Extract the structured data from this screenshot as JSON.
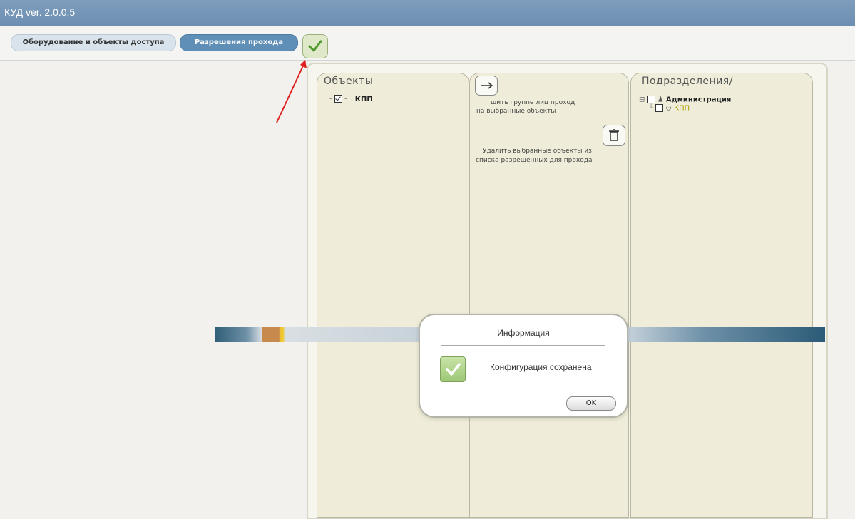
{
  "app": {
    "title": "КУД ver. 2.0.0.5"
  },
  "tabs": [
    {
      "label": "Оборудование и объекты доступа"
    },
    {
      "label": "Разрешения прохода"
    }
  ],
  "objects_panel": {
    "title": "Объекты",
    "items": [
      {
        "label": "КПП",
        "checked": true
      }
    ]
  },
  "actions_panel": {
    "grant_line1": "шить группе лиц проход",
    "grant_line2": "на выбранные объекты",
    "delete_line1": "Удалить выбранные объекты из",
    "delete_line2": "списка разрешенных для прохода"
  },
  "departments_panel": {
    "title": "Подразделения/",
    "items": [
      {
        "label": "Администрация",
        "level": 0
      },
      {
        "label": "КПП",
        "level": 1
      }
    ]
  },
  "dialog": {
    "title": "Информация",
    "message": "Конфигурация сохранена",
    "ok_label": "OK"
  },
  "colors": {
    "titlebar": "#6d8fb2",
    "active_tab": "#5f8fb6",
    "panel_bg": "#efedd9",
    "subitem_text": "#a8a000",
    "annotation_arrow": "#e02020"
  }
}
